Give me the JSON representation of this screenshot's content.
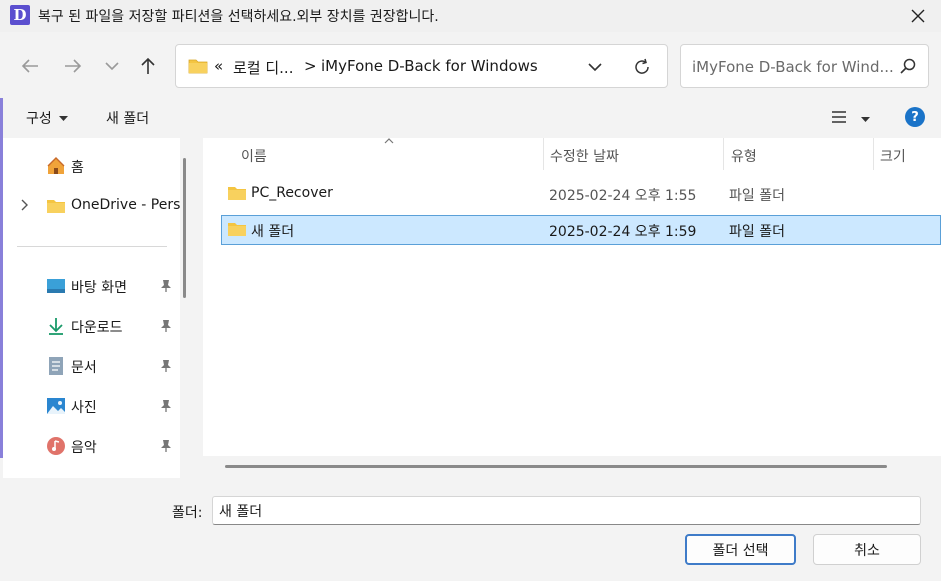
{
  "window": {
    "app_icon_letter": "D",
    "title": "복구 된 파일을 저장할 파티션을 선택하세요.외부 장치를 권장합니다."
  },
  "navigation": {
    "breadcrumb_prefix": "«",
    "breadcrumb_parent": "로컬 디...",
    "breadcrumb_separator": ">",
    "breadcrumb_current": "iMyFone D-Back for Windows",
    "search_placeholder": "iMyFone D-Back for Wind..."
  },
  "toolbar": {
    "organize_label": "구성",
    "new_folder_label": "새 폴더",
    "help_label": "?"
  },
  "sidebar": {
    "items": [
      {
        "label": "홈",
        "icon": "home-icon"
      },
      {
        "label": "OneDrive - Pers",
        "icon": "folder-icon"
      },
      {
        "label": "바탕 화면",
        "icon": "desktop-icon",
        "pinned": true
      },
      {
        "label": "다운로드",
        "icon": "download-icon",
        "pinned": true
      },
      {
        "label": "문서",
        "icon": "document-icon",
        "pinned": true
      },
      {
        "label": "사진",
        "icon": "pictures-icon",
        "pinned": true
      },
      {
        "label": "음악",
        "icon": "music-icon",
        "pinned": true
      }
    ]
  },
  "file_list": {
    "columns": [
      "이름",
      "수정한 날짜",
      "유형",
      "크기"
    ],
    "rows": [
      {
        "name": "PC_Recover",
        "date": "2025-02-24 오후 1:55",
        "type": "파일 폴더",
        "selected": false
      },
      {
        "name": "새 폴더",
        "date": "2025-02-24 오후 1:59",
        "type": "파일 폴더",
        "selected": true
      }
    ]
  },
  "footer": {
    "folder_label": "폴더:",
    "folder_value": "새 폴더",
    "select_button": "폴더 선택",
    "cancel_button": "취소"
  },
  "colors": {
    "accent": "#5b4fcf",
    "folder": "#f4c542",
    "selection": "#cce8ff",
    "help": "#1a73c8"
  }
}
